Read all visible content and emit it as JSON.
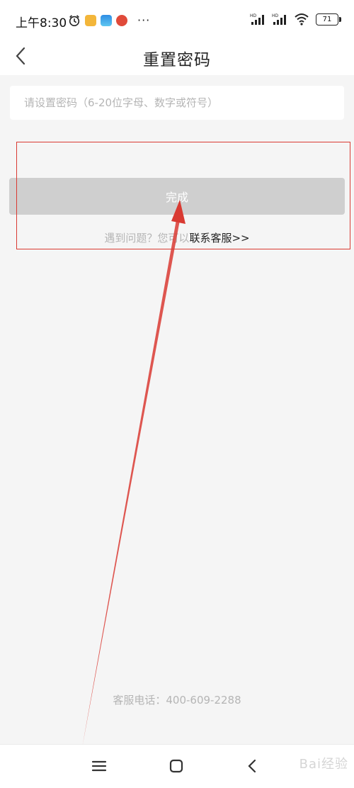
{
  "status_bar": {
    "time": "上午8:30",
    "battery": "71",
    "more": "···"
  },
  "header": {
    "title": "重置密码"
  },
  "form": {
    "password_placeholder": "请设置密码（6-20位字母、数字或符号）",
    "password_value": ""
  },
  "actions": {
    "done_label": "完成"
  },
  "help": {
    "prefix": "遇到问题？您可以",
    "link": "联系客服>>"
  },
  "footer": {
    "service_label": "客服电话：",
    "service_number": "400-609-2288"
  },
  "watermark": "Bai经验",
  "colors": {
    "accent_annotation": "#d93a32",
    "button_disabled": "#cfcfcf",
    "background": "#f5f5f5"
  },
  "icons": {
    "back": "chevron-left-icon",
    "alarm": "alarm-clock-icon",
    "wifi": "wifi-icon",
    "signal": "signal-icon",
    "menu": "menu-icon",
    "home": "home-square-icon",
    "nav_back": "chevron-left-icon"
  }
}
